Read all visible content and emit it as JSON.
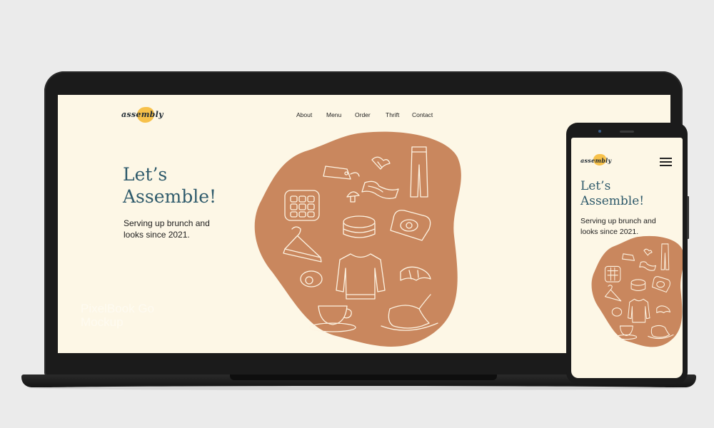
{
  "colors": {
    "background": "#ebebeb",
    "page_bg": "#fdf7e6",
    "blob": "#c9875e",
    "logo_accent": "#f7c14a",
    "heading": "#2e5a6b",
    "device": "#1b1b1b"
  },
  "site": {
    "logo": "assembly",
    "nav": [
      "About",
      "Menu",
      "Order",
      "Thrift",
      "Contact"
    ],
    "heading_line1": "Let’s",
    "heading_line2": "Assemble!",
    "subtitle_line1": "Serving up brunch and",
    "subtitle_line2": "looks since 2021."
  },
  "mobile": {
    "menu_icon": "hamburger-menu-icon"
  },
  "watermark": {
    "line1": "PixelBook Go",
    "line2": "Mockup"
  },
  "illustration_icons": [
    "waffle-icon",
    "price-tag-icon",
    "leaf-icon",
    "jeans-icon",
    "bacon-icon",
    "mushroom-icon",
    "pancakes-icon",
    "toast-egg-icon",
    "hanger-icon",
    "sweater-icon",
    "avocado-icon",
    "croissant-icon",
    "teacup-icon",
    "hat-icon"
  ]
}
